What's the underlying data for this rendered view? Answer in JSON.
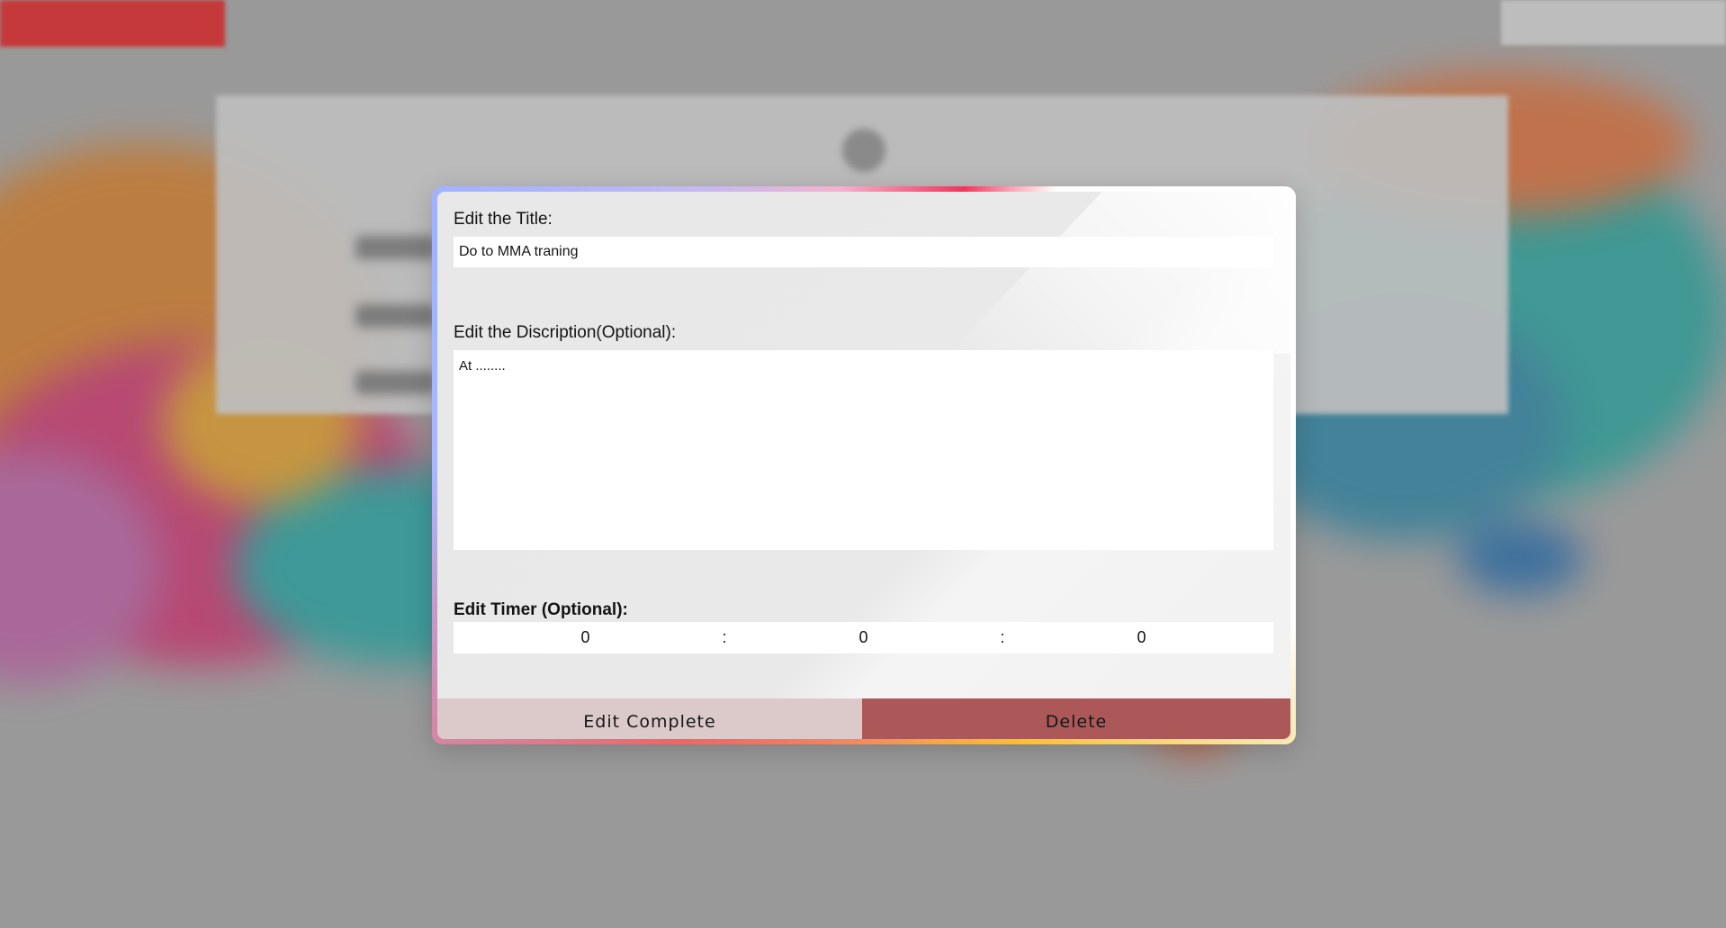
{
  "modal": {
    "title_label": "Edit the Title:",
    "title_value": "Do to MMA traning",
    "description_label": "Edit the Discription(Optional):",
    "description_value": "At ........",
    "timer_label": "Edit Timer (Optional):",
    "timer": {
      "hours": "0",
      "minutes": "0",
      "seconds": "0",
      "separator": ":"
    },
    "complete_button": "Edit Complete",
    "delete_button": "Delete"
  },
  "colors": {
    "complete_button_bg": "#dcc9c9",
    "delete_button_bg": "#ac5858",
    "modal_bg": "#eeeeee"
  }
}
